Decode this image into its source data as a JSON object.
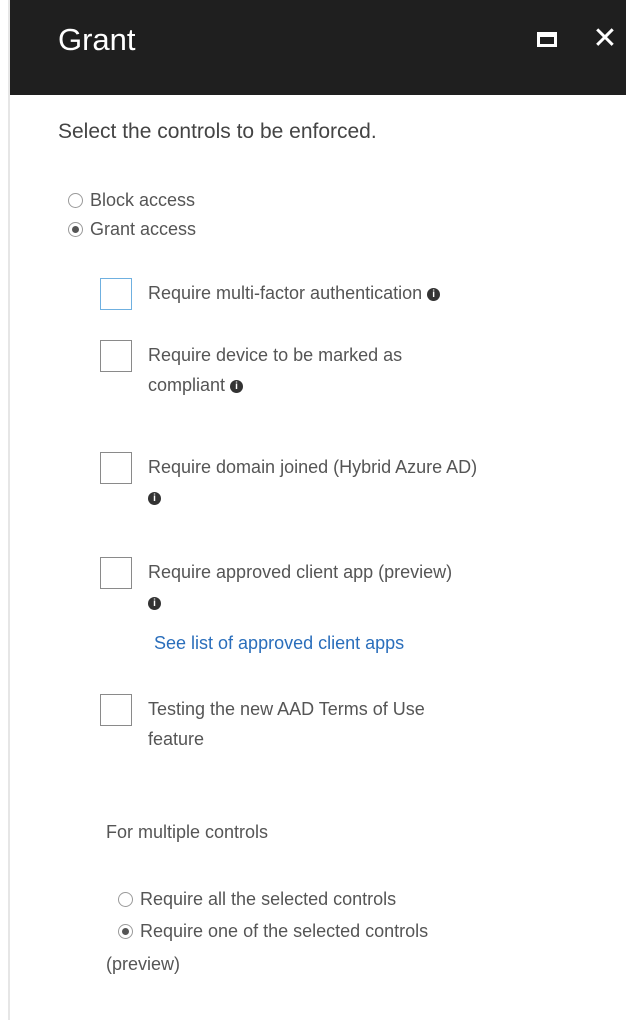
{
  "header": {
    "title": "Grant"
  },
  "instruction": "Select the controls to be enforced.",
  "access_options": [
    {
      "label": "Block access",
      "selected": false
    },
    {
      "label": "Grant access",
      "selected": true
    }
  ],
  "controls": {
    "mfa": "Require multi-factor authentication",
    "compliant_line1": "Require device to be marked as",
    "compliant_line2": "compliant",
    "domain_joined": "Require domain joined (Hybrid Azure AD)",
    "approved_app": "Require approved client app (preview)",
    "approved_link": "See list of approved client apps",
    "terms_line1": "Testing the new AAD Terms of Use",
    "terms_line2": "feature"
  },
  "multiple": {
    "label": "For multiple controls",
    "option_all": "Require all the selected controls",
    "option_one": "Require one of the selected controls",
    "option_one_suffix": "(preview)",
    "selected": "option_one"
  },
  "colors": {
    "header_bg": "#1f1f1f",
    "link": "#2a6ebb"
  }
}
